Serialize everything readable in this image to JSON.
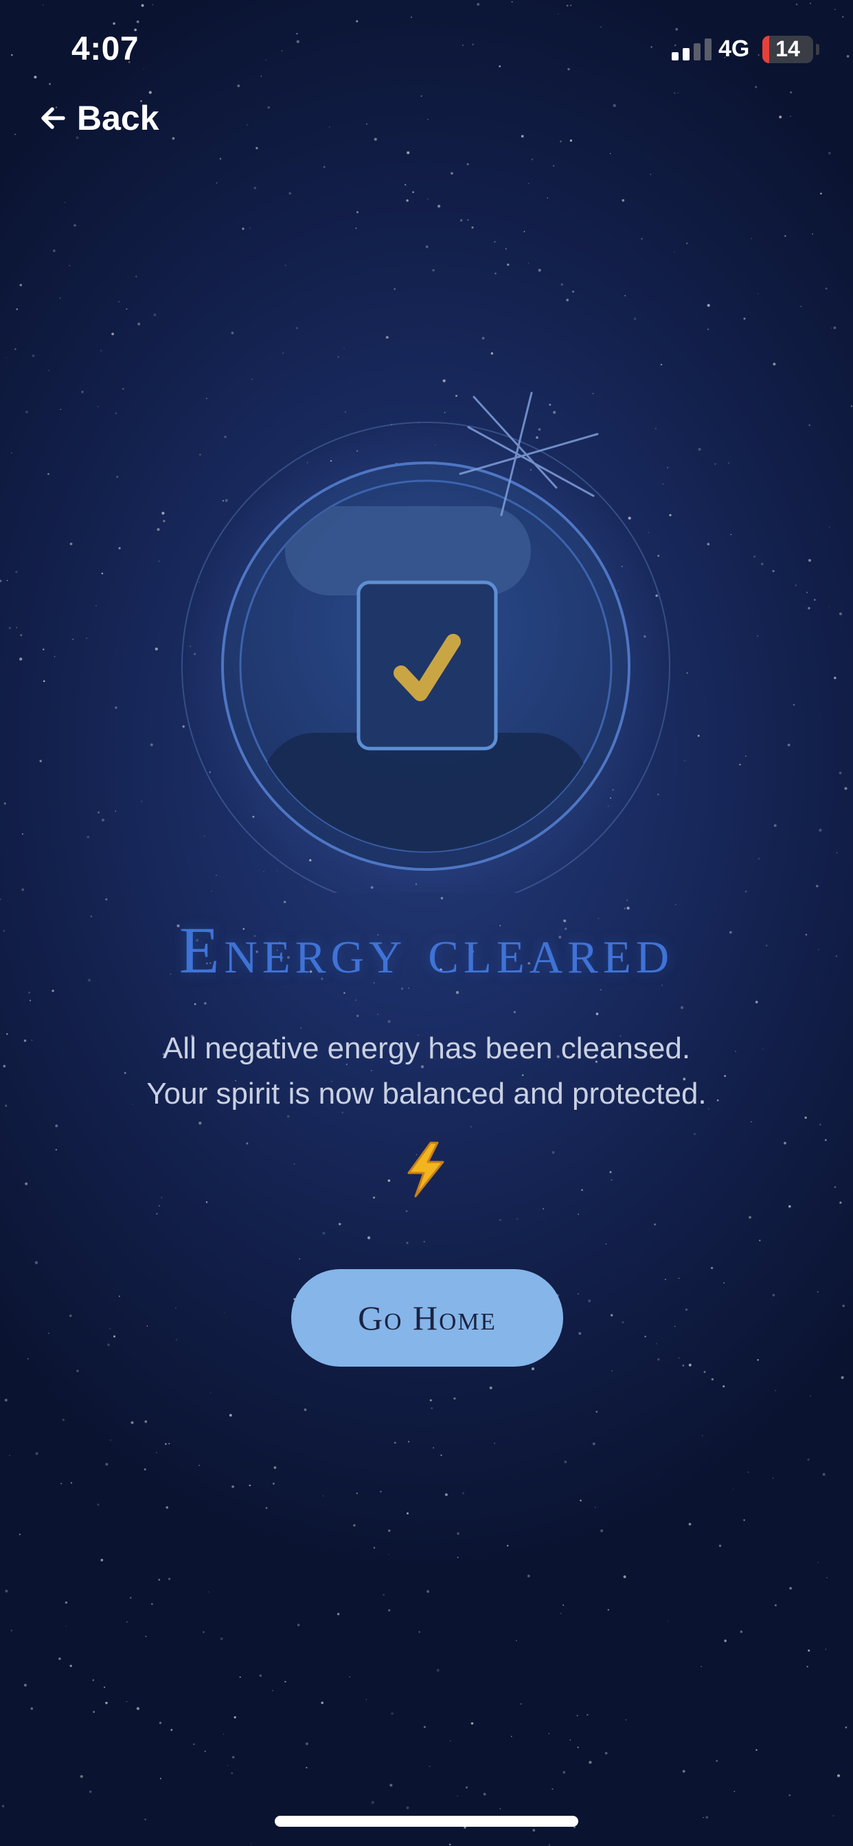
{
  "status_bar": {
    "time": "4:07",
    "network": "4G",
    "battery_level": "14"
  },
  "nav": {
    "back_label": "Back",
    "back_icon": "arrow-left-icon"
  },
  "emblem": {
    "icon": "checkmark-icon",
    "accent_color": "#c9a544"
  },
  "content": {
    "title": "Energy cleared",
    "description_line1": "All negative energy has been cleansed.",
    "description_line2": "Your spirit is now balanced and protected.",
    "decoration_icon": "lightning-bolt-icon"
  },
  "actions": {
    "home_label": "Go Home"
  },
  "colors": {
    "background": "#121f4a",
    "title": "#3f73d6",
    "button": "#85b5e9",
    "button_text": "#1b2340"
  }
}
